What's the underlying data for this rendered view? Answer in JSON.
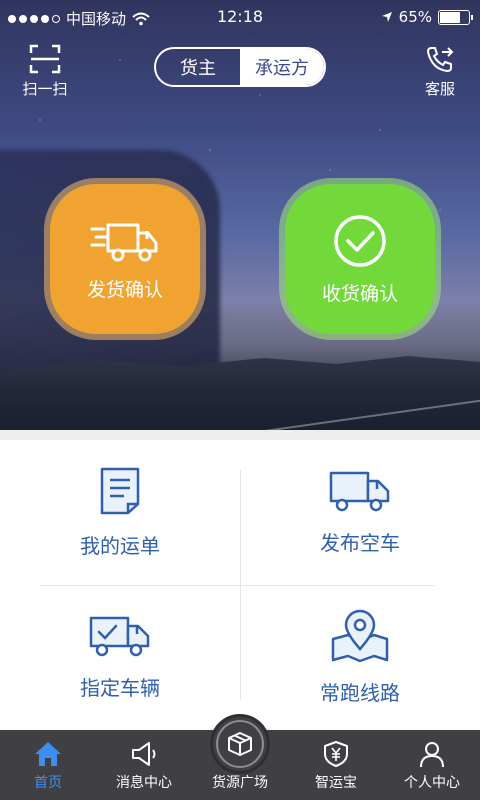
{
  "status_bar": {
    "carrier": "中国移动",
    "time": "12:18",
    "battery": "65%",
    "battery_level": 0.65
  },
  "header": {
    "scan_label": "扫一扫",
    "service_label": "客服",
    "segment": {
      "active": "货主",
      "inactive": "承运方"
    }
  },
  "hero_actions": {
    "ship_confirm": "发货确认",
    "receive_confirm": "收货确认"
  },
  "grid": {
    "my_waybill": "我的运单",
    "publish_empty_truck": "发布空车",
    "assign_vehicle": "指定车辆",
    "regular_route": "常跑线路"
  },
  "tabbar": {
    "home": "首页",
    "messages": "消息中心",
    "cargo_plaza": "货源广场",
    "zhiyunbao": "智运宝",
    "profile": "个人中心"
  },
  "colors": {
    "ship": "#f0a330",
    "receive": "#73d93a",
    "grid_text": "#2f5fad",
    "tab_active": "#3e8ef0",
    "tab_bg": "#404044"
  },
  "icons": {
    "scan": "scan-icon",
    "service": "phone-transfer-icon",
    "ship": "truck-delivery-icon",
    "receive": "check-circle-icon",
    "waybill": "document-icon",
    "empty_truck": "truck-icon",
    "assign": "truck-check-icon",
    "route": "map-pin-icon",
    "home": "home-icon",
    "messages": "megaphone-icon",
    "cargo": "box-icon",
    "zhiyunbao": "shield-yuan-icon",
    "profile": "user-icon"
  }
}
